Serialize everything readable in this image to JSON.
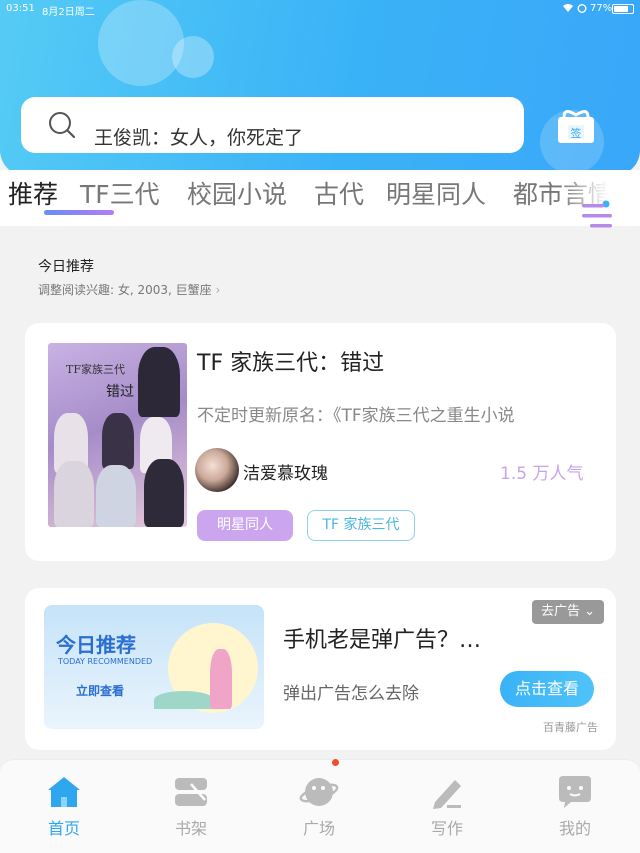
{
  "status_bar": {
    "time": "03:51",
    "date": "8月2日周二",
    "battery": "77%",
    "battery_level": 0.77
  },
  "search": {
    "placeholder": "王俊凯：女人，你死定了"
  },
  "sign_in": {
    "label": "签"
  },
  "tabs": [
    {
      "label": "推荐",
      "active": true
    },
    {
      "label": "TF三代"
    },
    {
      "label": "校园小说"
    },
    {
      "label": "古代"
    },
    {
      "label": "明星同人"
    },
    {
      "label": "都市言情"
    }
  ],
  "today": {
    "title": "今日推荐",
    "subtitle": "调整阅读兴趣: 女, 2003, 巨蟹座"
  },
  "book": {
    "cover_text1": "TF家族三代",
    "cover_text2": "错过",
    "title": "TF 家族三代：错过",
    "desc": "不定时更新原名：《TF家族三代之重生小说",
    "author": "洁爱慕玫瑰",
    "popularity": "1.5 万人气",
    "tags": [
      "明星同人",
      "TF 家族三代"
    ]
  },
  "ad": {
    "img_title": "今日推荐",
    "img_sub": "TODAY RECOMMENDED",
    "img_cta": "立即查看",
    "title": "手机老是弹广告？…",
    "desc": "弹出广告怎么去除",
    "button": "点击查看",
    "close": "去广告",
    "source": "百青藤广告"
  },
  "nav": [
    {
      "label": "首页",
      "icon": "home-icon",
      "active": true
    },
    {
      "label": "书架",
      "icon": "bookshelf-icon"
    },
    {
      "label": "广场",
      "icon": "planet-icon"
    },
    {
      "label": "写作",
      "icon": "pen-icon"
    },
    {
      "label": "我的",
      "icon": "chat-face-icon"
    }
  ],
  "colors": {
    "accent": "#3ab2f7",
    "tag_purple": "#cba6ef",
    "popularity": "#c8a4ec",
    "badge": "#f04e2f"
  }
}
